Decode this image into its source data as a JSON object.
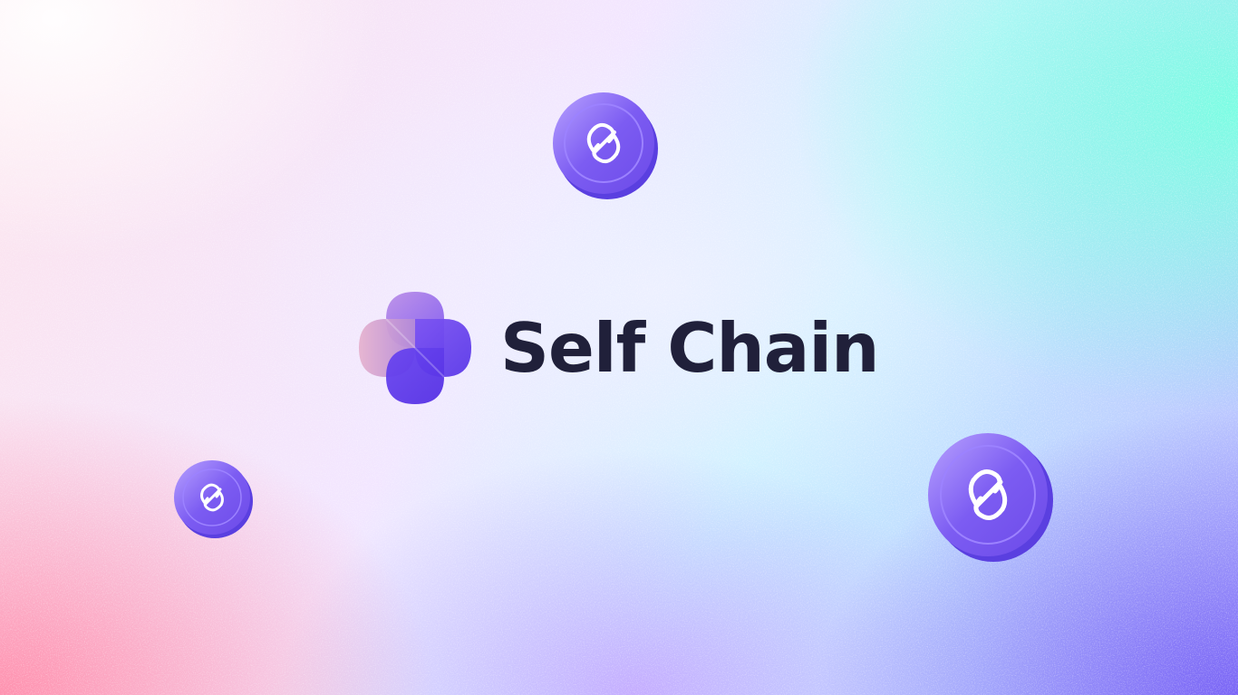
{
  "brand": {
    "name": "Self Chain",
    "logo_icon": "clover-logo-icon"
  },
  "decorations": {
    "coin_icon": "self-chain-coin-icon",
    "coin_count": 3
  },
  "colors": {
    "text": "#20203a",
    "coin_face": "#7c5cf2",
    "coin_edge": "#5a3fe0",
    "logo_purple": "#6a48f0",
    "logo_pink": "#d9a6d8"
  }
}
